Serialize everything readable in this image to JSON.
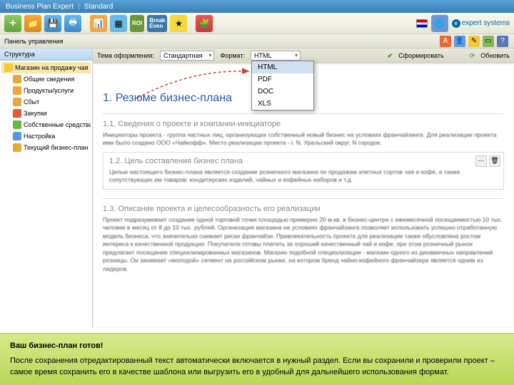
{
  "titlebar": {
    "app": "Business Plan Expert",
    "mode": "Standard"
  },
  "brand": "expert systems",
  "toolbar": {
    "add": "+",
    "roi": "ROI",
    "break": "Break\nEven"
  },
  "sidebar": {
    "panel_label": "Панель управления",
    "section": "Структура",
    "items": [
      {
        "label": "Магазин на продажу чая",
        "cls": "ti-folder",
        "sel": true
      },
      {
        "label": "Общие сведения",
        "cls": "ti-doc",
        "child": true
      },
      {
        "label": "Продукты/услуги",
        "cls": "ti-doc",
        "child": true
      },
      {
        "label": "Сбыт",
        "cls": "ti-doc",
        "child": true
      },
      {
        "label": "Закупки",
        "cls": "ti-red",
        "child": true
      },
      {
        "label": "Собственные средства",
        "cls": "ti-green",
        "child": true
      },
      {
        "label": "Настройка",
        "cls": "ti-blue",
        "child": true
      },
      {
        "label": "Текущий бизнес-план",
        "cls": "ti-doc",
        "child": true
      }
    ]
  },
  "main_header": {
    "type_label": "Тема оформления:",
    "type_value": "Стандартная",
    "format_label": "Формат:",
    "format_value": "HTML",
    "generate": "Сформировать",
    "refresh": "Обновить"
  },
  "dropdown": [
    "HTML",
    "PDF",
    "DOC",
    "XLS"
  ],
  "content": {
    "h1": "1. Резюме бизнес-плана",
    "s1": {
      "title": "1.1. Сведения о проекте и компании-инициаторе",
      "body": "Инициаторы проекта - группа частных лиц, организующих собственный новый бизнес на условиях франчайзинга. Для реализации проекта ими было создано ООО «Чайкофф». Место реализации проекта - г. N, Уральский округ, N городок."
    },
    "s2": {
      "title": "1.2. Цель составления бизнес плана",
      "body": "Целью настоящего бизнес-плана является создание розничного магазина по продажам элитных сортов чая и кофе, а также сопутствующих им товаров: кондитерских изделий, чайных и кофейных наборов и т.д."
    },
    "s3": {
      "title": "1.3. Описание проекта и целесообразность его реализации",
      "body": "Проект подразумевает создание одной торговой точки площадью примерно 20 м.кв. в бизнес-центре с ежемесячной посещаемостью 10 тыс. человек в месяц от 8 до 10 тыс. рублей. Организация магазина на условиях франчайзинга позволяет использовать успешно отработанную модель бизнеса, что значительно снижает риски франчайзи. Привлекательность проекта для реализации также обусловлена ростом интереса к качественной продукции. Покупатели готовы платить за хороший качественный чай и кофе, при этом розничный рынок предлагает посещение специализированных магазинов. Магазин подобной специализации - магазин одного из динамичных направлений розницы. Он занимает «молодой» сегмент на российском рынке, на котором бренд чайно-кофейного франчайзера является одним из лидеров."
    }
  },
  "footer": {
    "title": "Ваш бизнес-план готов!",
    "body": "После сохранения отредактированный текст автоматически включается в нужный раздел. Если вы сохранили и проверили проект – самое время сохранить его в качестве шаблона или выгрузить его в удобный для дальнейшего использования формат."
  }
}
